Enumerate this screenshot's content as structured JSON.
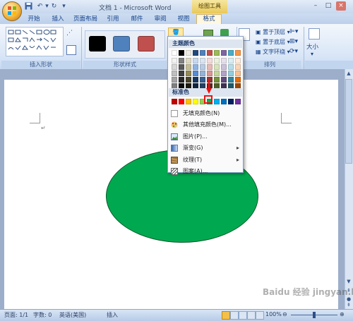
{
  "title_bar": {
    "document_title": "文档 1 - Microsoft Word",
    "context_tab_group": "绘图工具"
  },
  "tabs": [
    "开始",
    "插入",
    "页面布局",
    "引用",
    "邮件",
    "审阅",
    "视图",
    "格式"
  ],
  "ribbon": {
    "groups": {
      "insert_shapes": "插入形状",
      "shape_styles": "形状样式",
      "arrange": "排列"
    },
    "arrange_buttons": {
      "bring_front": "置于顶层",
      "send_back": "置于底层",
      "text_wrap": "文字环绕"
    },
    "size_label": "大小",
    "style_swatch_colors": [
      "#000000",
      "#4f81bd",
      "#c0504d"
    ]
  },
  "fill_menu": {
    "theme_header": "主题颜色",
    "standard_header": "标准色",
    "theme_top_colors": [
      "#ffffff",
      "#000000",
      "#eeece1",
      "#1f497d",
      "#4f81bd",
      "#c0504d",
      "#9bbb59",
      "#8064a2",
      "#4bacc6",
      "#f79646"
    ],
    "theme_shades": [
      [
        "#f2f2f2",
        "#808080",
        "#ddd9c3",
        "#c6d9f0",
        "#dbe5f1",
        "#f2dcdb",
        "#ebf1dd",
        "#e5e0ec",
        "#dbeef3",
        "#fdeada"
      ],
      [
        "#d8d8d8",
        "#595959",
        "#c4bd97",
        "#8db3e2",
        "#b8cce4",
        "#e5b9b7",
        "#d7e3bc",
        "#ccc1d9",
        "#b7dde8",
        "#fbd5b5"
      ],
      [
        "#bfbfbf",
        "#3f3f3f",
        "#938953",
        "#548dd4",
        "#95b3d7",
        "#d99694",
        "#c3d69b",
        "#b2a2c7",
        "#92cddc",
        "#fac08f"
      ],
      [
        "#a5a5a5",
        "#262626",
        "#494429",
        "#17365d",
        "#366092",
        "#953734",
        "#76923c",
        "#5f497a",
        "#31859b",
        "#e36c09"
      ],
      [
        "#7f7f7f",
        "#0c0c0c",
        "#1d1b10",
        "#0f243e",
        "#244061",
        "#632423",
        "#4f6128",
        "#3f3151",
        "#205867",
        "#974806"
      ]
    ],
    "standard_colors": [
      "#c00000",
      "#ff0000",
      "#ffc000",
      "#ffff00",
      "#92d050",
      "#00b050",
      "#00b0f0",
      "#0070c0",
      "#002060",
      "#7030a0"
    ],
    "selected_color": "#00b050",
    "items": [
      {
        "label": "无填充颜色(N)",
        "icon": "no-fill-icon"
      },
      {
        "label": "其他填充颜色(M)...",
        "icon": "color-palette-icon"
      },
      {
        "label": "图片(P)...",
        "icon": "picture-icon"
      },
      {
        "label": "渐变(G)",
        "icon": "gradient-icon"
      },
      {
        "label": "纹理(T)",
        "icon": "texture-icon"
      },
      {
        "label": "图案(A)...",
        "icon": "pattern-icon"
      }
    ]
  },
  "document": {
    "shape_fill": "#00a94f"
  },
  "status_bar": {
    "page": "页面: 1/1",
    "words": "字数: 0",
    "language": "英语(美国)",
    "mode": "插入",
    "zoom": "100%"
  },
  "watermark": "Baidu 经验 jingyan.baidu.com"
}
